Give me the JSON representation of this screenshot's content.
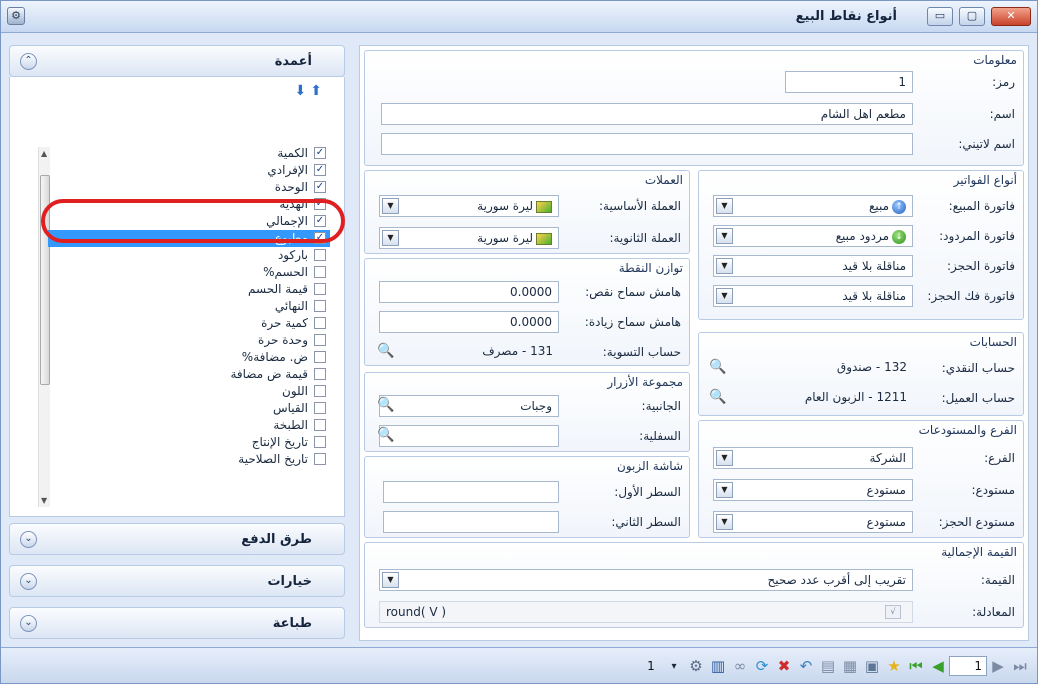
{
  "window": {
    "title": "أنواع نقاط البيع",
    "close_label": "✕",
    "max_label": "▢",
    "min_label": "▭"
  },
  "left": {
    "columns_header": "أعمدة",
    "columns": [
      {
        "label": "الكمية",
        "checked": true
      },
      {
        "label": "الإفرادي",
        "checked": true
      },
      {
        "label": "الوحدة",
        "checked": true
      },
      {
        "label": "الهدية",
        "checked": true
      },
      {
        "label": "الإجمالي",
        "checked": true
      },
      {
        "label": "مطبوع",
        "checked": true,
        "selected": true
      },
      {
        "label": "باركود",
        "checked": false
      },
      {
        "label": "الحسم%",
        "checked": false
      },
      {
        "label": "قيمة الحسم",
        "checked": false
      },
      {
        "label": "النهائي",
        "checked": false
      },
      {
        "label": "كمية حرة",
        "checked": false
      },
      {
        "label": "وحدة حرة",
        "checked": false
      },
      {
        "label": "ض. مضافة%",
        "checked": false
      },
      {
        "label": "قيمة ض مضافة",
        "checked": false
      },
      {
        "label": "اللون",
        "checked": false
      },
      {
        "label": "القياس",
        "checked": false
      },
      {
        "label": "الطبخة",
        "checked": false
      },
      {
        "label": "تاريخ الإنتاج",
        "checked": false
      },
      {
        "label": "تاريخ الصلاحية",
        "checked": false
      }
    ],
    "payment_header": "طرق الدفع",
    "options_header": "خيارات",
    "print_header": "طباعة"
  },
  "info": {
    "legend": "معلومات",
    "code_label": "رمز:",
    "code_value": "1",
    "name_label": "اسم:",
    "name_value": "مطعم اهل الشام",
    "latin_label": "اسم لاتيني:",
    "latin_value": ""
  },
  "invoices": {
    "legend": "أنواع الفواتير",
    "sale_label": "فاتورة المبيع:",
    "sale_value": "مبيع",
    "return_label": "فاتورة المردود:",
    "return_value": "مردود مبيع",
    "booking_label": "فاتورة الحجز:",
    "booking_value": "مناقلة بلا قيد",
    "unbook_label": "فاتورة فك الحجز:",
    "unbook_value": "مناقلة بلا قيد"
  },
  "currencies": {
    "legend": "العملات",
    "base_label": "العملة الأساسية:",
    "base_value": "ليرة سورية",
    "second_label": "العملة الثانوية:",
    "second_value": "ليرة سورية"
  },
  "balance": {
    "legend": "توازن النقطة",
    "minus_label": "هامش سماح نقص:",
    "minus_value": "0.0000",
    "plus_label": "هامش سماح زيادة:",
    "plus_value": "0.0000",
    "settle_label": "حساب التسوية:",
    "settle_value": "131 - مصرف"
  },
  "accounts": {
    "legend": "الحسابات",
    "cash_label": "حساب النقدي:",
    "cash_value": "132 - صندوق",
    "client_label": "حساب العميل:",
    "client_value": "1211 - الزبون العام"
  },
  "buttons_group": {
    "legend": "مجموعة الأزرار",
    "side_label": "الجانبية:",
    "side_value": "وجبات",
    "bottom_label": "السفلية:",
    "bottom_value": ""
  },
  "branch": {
    "legend": "الفرع والمستودعات",
    "branch_label": "الفرع:",
    "branch_value": "الشركة",
    "store_label": "مستودع:",
    "store_value": "مستودع",
    "bstore_label": "مستودع الحجز:",
    "bstore_value": "مستودع"
  },
  "customer_screen": {
    "legend": "شاشة الزبون",
    "line1_label": "السطر الأول:",
    "line1_value": "",
    "line2_label": "السطر الثاني:",
    "line2_value": ""
  },
  "total": {
    "legend": "القيمة الإجمالية",
    "value_label": "القيمة:",
    "value_value": "تقريب إلى أقرب عدد صحيح",
    "formula_label": "المعادلة:",
    "formula_value": "round( V )"
  },
  "status": {
    "page_value": "1",
    "counter": "1"
  }
}
